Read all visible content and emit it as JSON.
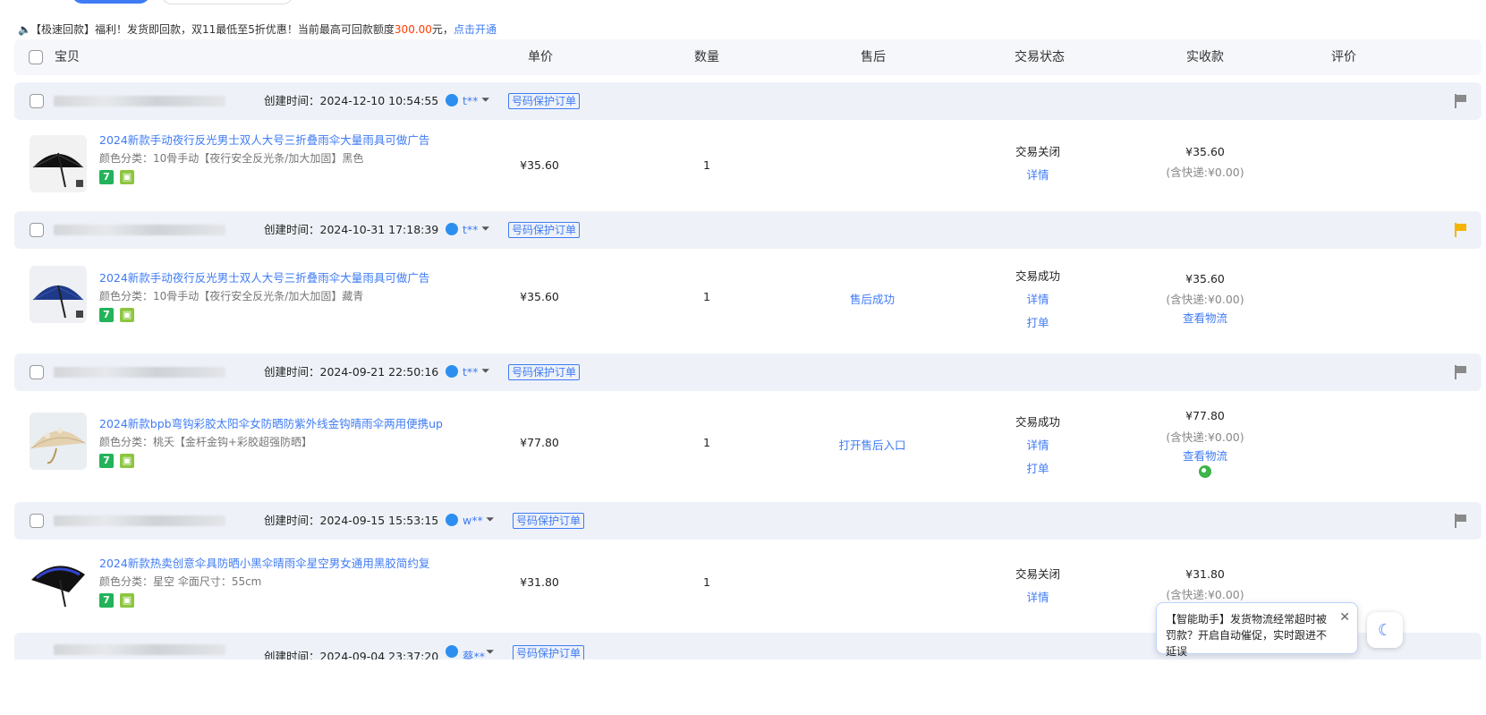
{
  "notice": {
    "prefix": "【极速回款】福利！发货即回款，双11最低至5折优惠！当前最高可回款额度",
    "amount": "300.00",
    "suffix": "元，",
    "link": "点击开通"
  },
  "header": {
    "item": "宝贝",
    "price": "单价",
    "qty": "数量",
    "aftersale": "售后",
    "status": "交易状态",
    "received": "实收款",
    "review": "评价"
  },
  "orders": [
    {
      "ctime": "创建时间：2024-12-10 10:54:55",
      "buyer": "t**",
      "tag": "号码保护订单",
      "flag_color": "#8a8a8a",
      "title": "2024新款手动夜行反光男士双人大号三折叠雨伞大量雨具可做广告",
      "sku": "颜色分类：10骨手动【夜行安全反光条/加大加固】黑色",
      "price": "¥35.60",
      "qty": "1",
      "aftersale": "",
      "status": "交易关闭",
      "detail": "详情",
      "print": "",
      "received": "¥35.60",
      "shipping": "(含快递:¥0.00)",
      "logistics": ""
    },
    {
      "ctime": "创建时间：2024-10-31 17:18:39",
      "buyer": "t**",
      "tag": "号码保护订单",
      "flag_color": "#f5b400",
      "title": "2024新款手动夜行反光男士双人大号三折叠雨伞大量雨具可做广告",
      "sku": "颜色分类：10骨手动【夜行安全反光条/加大加固】藏青",
      "price": "¥35.60",
      "qty": "1",
      "aftersale": "售后成功",
      "status": "交易成功",
      "detail": "详情",
      "print": "打单",
      "received": "¥35.60",
      "shipping": "(含快递:¥0.00)",
      "logistics": "查看物流"
    },
    {
      "ctime": "创建时间：2024-09-21 22:50:16",
      "buyer": "t**",
      "tag": "号码保护订单",
      "flag_color": "#8a8a8a",
      "title": "2024新款bpb弯钩彩胶太阳伞女防晒防紫外线金钩晴雨伞两用便携up",
      "sku": "颜色分类：桃夭【金杆金钩+彩胶超强防晒】",
      "price": "¥77.80",
      "qty": "1",
      "aftersale": "打开售后入口",
      "status": "交易成功",
      "detail": "详情",
      "print": "打单",
      "received": "¥77.80",
      "shipping": "(含快递:¥0.00)",
      "logistics": "查看物流"
    },
    {
      "ctime": "创建时间：2024-09-15 15:53:15",
      "buyer": "w**",
      "tag": "号码保护订单",
      "flag_color": "#8a8a8a",
      "title": "2024新款热卖创意伞具防晒小黑伞晴雨伞星空男女通用黑胶简约复",
      "sku": "颜色分类：星空  伞面尺寸：55cm",
      "price": "¥31.80",
      "qty": "1",
      "aftersale": "",
      "status": "交易关闭",
      "detail": "详情",
      "print": "",
      "received": "¥31.80",
      "shipping": "(含快递:¥0.00)",
      "logistics": ""
    }
  ],
  "partial_order": {
    "ctime": "创建时间：2024-09-04 23:37:20",
    "buyer": "蔡**",
    "tag": "号码保护订单"
  },
  "popup": {
    "text": "【智能助手】发货物流经常超时被罚款？开启自动催促，实时跟进不延误",
    "close": "✕"
  }
}
